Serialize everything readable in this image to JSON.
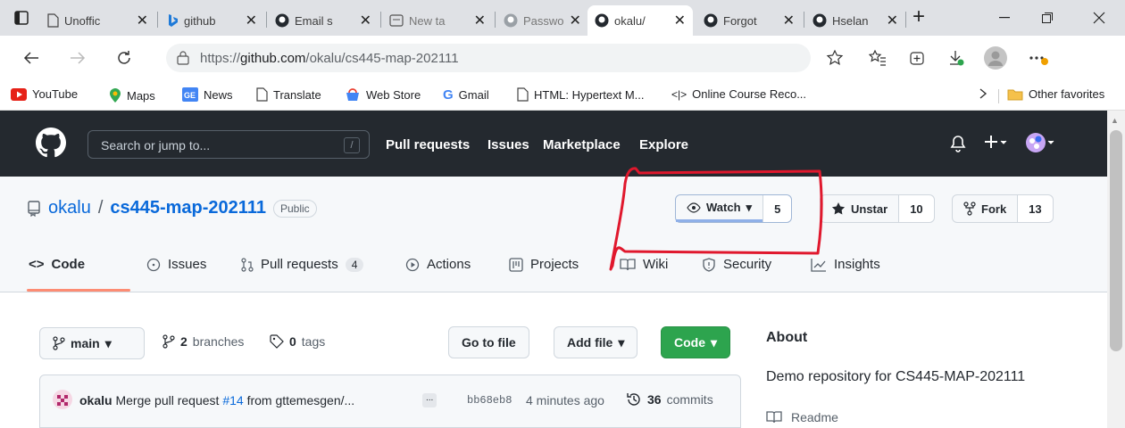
{
  "browser": {
    "tabs": [
      {
        "title": "Unoffic"
      },
      {
        "title": "github"
      },
      {
        "title": "Email s"
      },
      {
        "title": "New ta"
      },
      {
        "title": "Passwo"
      },
      {
        "title": "okalu/"
      },
      {
        "title": "Forgot"
      },
      {
        "title": "Hselan"
      }
    ],
    "url_prefix": "https://",
    "url_host": "github.com",
    "url_path": "/okalu/cs445-map-202111",
    "bookmarks": [
      "YouTube",
      "Maps",
      "News",
      "Translate",
      "Web Store",
      "Gmail",
      "HTML: Hypertext M...",
      "Online Course Reco..."
    ],
    "other_favorites": "Other favorites"
  },
  "github": {
    "search_placeholder": "Search or jump to...",
    "search_key": "/",
    "nav": [
      "Pull requests",
      "Issues",
      "Marketplace",
      "Explore"
    ]
  },
  "repo": {
    "owner": "okalu",
    "separator": "/",
    "name": "cs445-map-202111",
    "visibility": "Public",
    "watch_label": "Watch",
    "watch_count": "5",
    "star_label": "Unstar",
    "star_count": "10",
    "fork_label": "Fork",
    "fork_count": "13",
    "tabs": [
      "Code",
      "Issues",
      "Pull requests",
      "Actions",
      "Projects",
      "Wiki",
      "Security",
      "Insights"
    ],
    "pr_count": "4"
  },
  "content": {
    "branch": "main",
    "branches_count": "2",
    "branches_label": "branches",
    "tags_count": "0",
    "tags_label": "tags",
    "go_to_file": "Go to file",
    "add_file": "Add file",
    "code_button": "Code",
    "commit_author": "okalu",
    "commit_msg_prefix": "Merge pull request",
    "commit_pr_link": "#14",
    "commit_msg_suffix": "from gttemesgen/...",
    "commit_ellipsis": "...",
    "commit_sha": "bb68eb8",
    "commit_time": "4 minutes ago",
    "commits_count": "36",
    "commits_label": "commits"
  },
  "about": {
    "heading": "About",
    "description": "Demo repository for CS445-MAP-202111",
    "readme": "Readme"
  },
  "colors": {
    "annotation": "#e0182d",
    "accent": "#0969da",
    "green": "#2da44e"
  }
}
